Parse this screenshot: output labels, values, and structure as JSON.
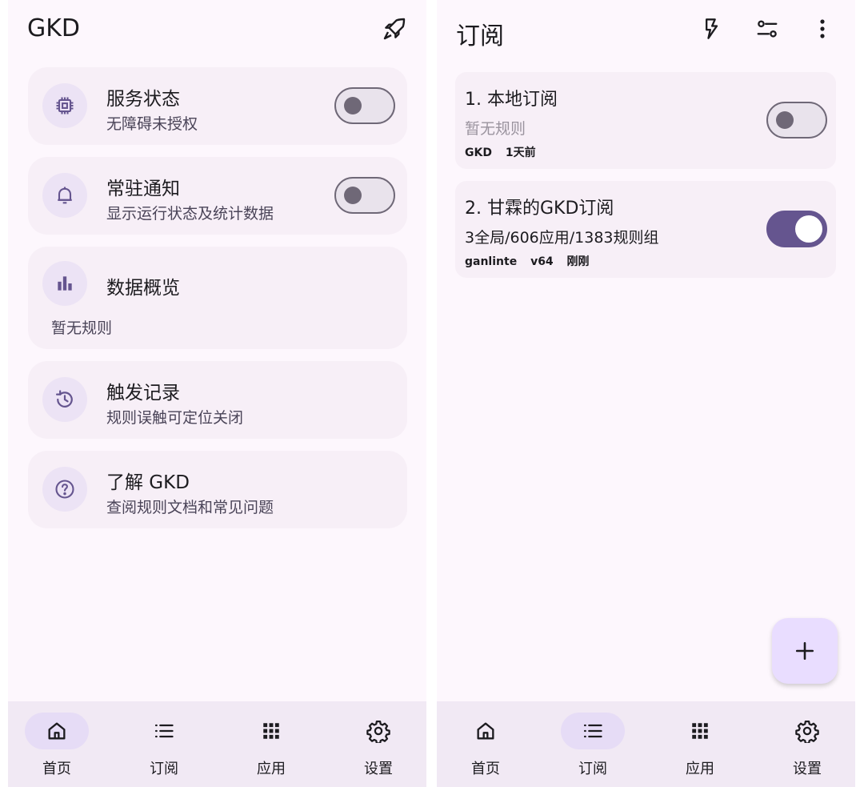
{
  "home": {
    "app_title": "GKD",
    "cards": {
      "service": {
        "title": "服务状态",
        "subtitle": "无障碍未授权"
      },
      "notify": {
        "title": "常驻通知",
        "subtitle": "显示运行状态及统计数据"
      },
      "stats": {
        "title": "数据概览",
        "subtitle": "暂无规则"
      },
      "trigger": {
        "title": "触发记录",
        "subtitle": "规则误触可定位关闭"
      },
      "learn": {
        "title": "了解 GKD",
        "subtitle": "查阅规则文档和常见问题"
      }
    },
    "toggles": {
      "service_on": false,
      "notify_on": false
    }
  },
  "subscriptions": {
    "title": "订阅",
    "items": [
      {
        "title": "1. 本地订阅",
        "description": "暂无规则",
        "meta": [
          "GKD",
          "1天前"
        ],
        "enabled": false
      },
      {
        "title": "2. 甘霖的GKD订阅",
        "description": "3全局/606应用/1383规则组",
        "meta": [
          "ganlinte",
          "v64",
          "刚刚"
        ],
        "enabled": true
      }
    ],
    "fab_symbol": "+"
  },
  "nav": {
    "items": [
      {
        "label": "首页",
        "icon": "home-icon"
      },
      {
        "label": "订阅",
        "icon": "list-icon"
      },
      {
        "label": "应用",
        "icon": "apps-grid-icon"
      },
      {
        "label": "设置",
        "icon": "gear-icon"
      }
    ],
    "left_active": "首页",
    "right_active": "订阅"
  },
  "colors": {
    "accent": "#65558f",
    "background": "#fdf7fd",
    "card": "#f7eff7",
    "navbar": "#f1e9f4"
  }
}
